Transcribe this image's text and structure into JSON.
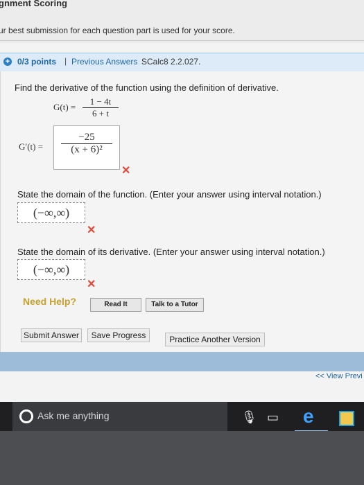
{
  "header": {
    "title": "gnment Scoring",
    "note": "ur best submission for each question part is used for your score."
  },
  "question_bar": {
    "points": "0/3 points",
    "separator": "|",
    "previous_answers": "Previous Answers",
    "reference": "SCalc8 2.2.027."
  },
  "question": {
    "prompt": "Find the derivative of the function using the definition of derivative.",
    "function_label": "G(t) =",
    "function_num": "1 − 4t",
    "function_den": "6 + t",
    "derivative_label": "G′(t) =",
    "derivative_answer_num": "−25",
    "derivative_answer_den": "(x + 6)²",
    "domain_prompt": "State the domain of the function. (Enter your answer using interval notation.)",
    "domain_answer": "(−∞,∞)",
    "derivative_domain_prompt": "State the domain of its derivative. (Enter your answer using interval notation.)",
    "derivative_domain_answer": "(−∞,∞)",
    "incorrect_mark": "✕"
  },
  "help": {
    "label": "Need Help?",
    "read_it": "Read It",
    "talk_to_tutor": "Talk to a Tutor"
  },
  "actions": {
    "submit": "Submit Answer",
    "save": "Save Progress",
    "practice": "Practice Another Version"
  },
  "nav": {
    "view_previous": "<< View Previ"
  },
  "taskbar": {
    "search_placeholder": "Ask me anything",
    "icons": [
      "cortana-circle-icon",
      "microphone-icon",
      "task-view-icon",
      "edge-icon",
      "store-icon"
    ]
  },
  "colors": {
    "accent_blue": "#2167a9",
    "error_red": "#e04a3a",
    "help_gold": "#c4a12d",
    "bar_blue": "#9cbcd9"
  }
}
